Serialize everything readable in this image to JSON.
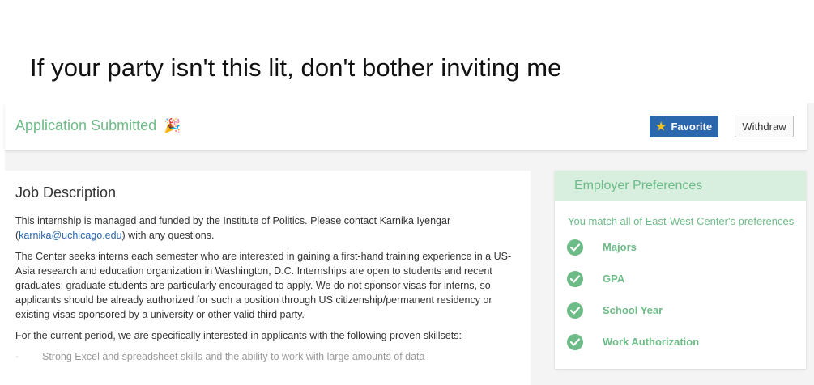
{
  "caption": "If your party isn't this lit, don't bother inviting me",
  "header": {
    "status_title": "Application Submitted",
    "status_emoji": "🎉",
    "favorite_label": "Favorite",
    "withdraw_label": "Withdraw"
  },
  "job": {
    "title": "Job Description",
    "p1_before": "This internship is managed and funded by the Institute of Politics. Please contact Karnika Iyengar (",
    "p1_email": "karnika@uchicago.edu",
    "p1_after": ") with any questions.",
    "p2": "The Center seeks interns each semester who are interested in gaining a first-hand training experience in a US-Asia research and education organization in Washington, D.C. Internships are open to students and recent graduates; graduate students are particularly encouraged to apply. We do not sponsor visas for interns, so applicants should be already authorized for such a position through US citizenship/permanent residency or existing visas sponsored by a university or other valid third party.",
    "p3": "For the current period, we are specifically interested in applicants with the following proven skillsets:",
    "skills": [
      "Strong Excel and spreadsheet skills and the ability to work with large amounts of data"
    ]
  },
  "preferences": {
    "title": "Employer Preferences",
    "match_text": "You match all of East-West Center's preferences",
    "items": [
      {
        "label": "Majors"
      },
      {
        "label": "GPA"
      },
      {
        "label": "School Year"
      },
      {
        "label": "Work Authorization"
      }
    ]
  },
  "colors": {
    "accent_green": "#6dbb87",
    "primary_blue": "#2b67ad",
    "star_yellow": "#f2c11b"
  }
}
